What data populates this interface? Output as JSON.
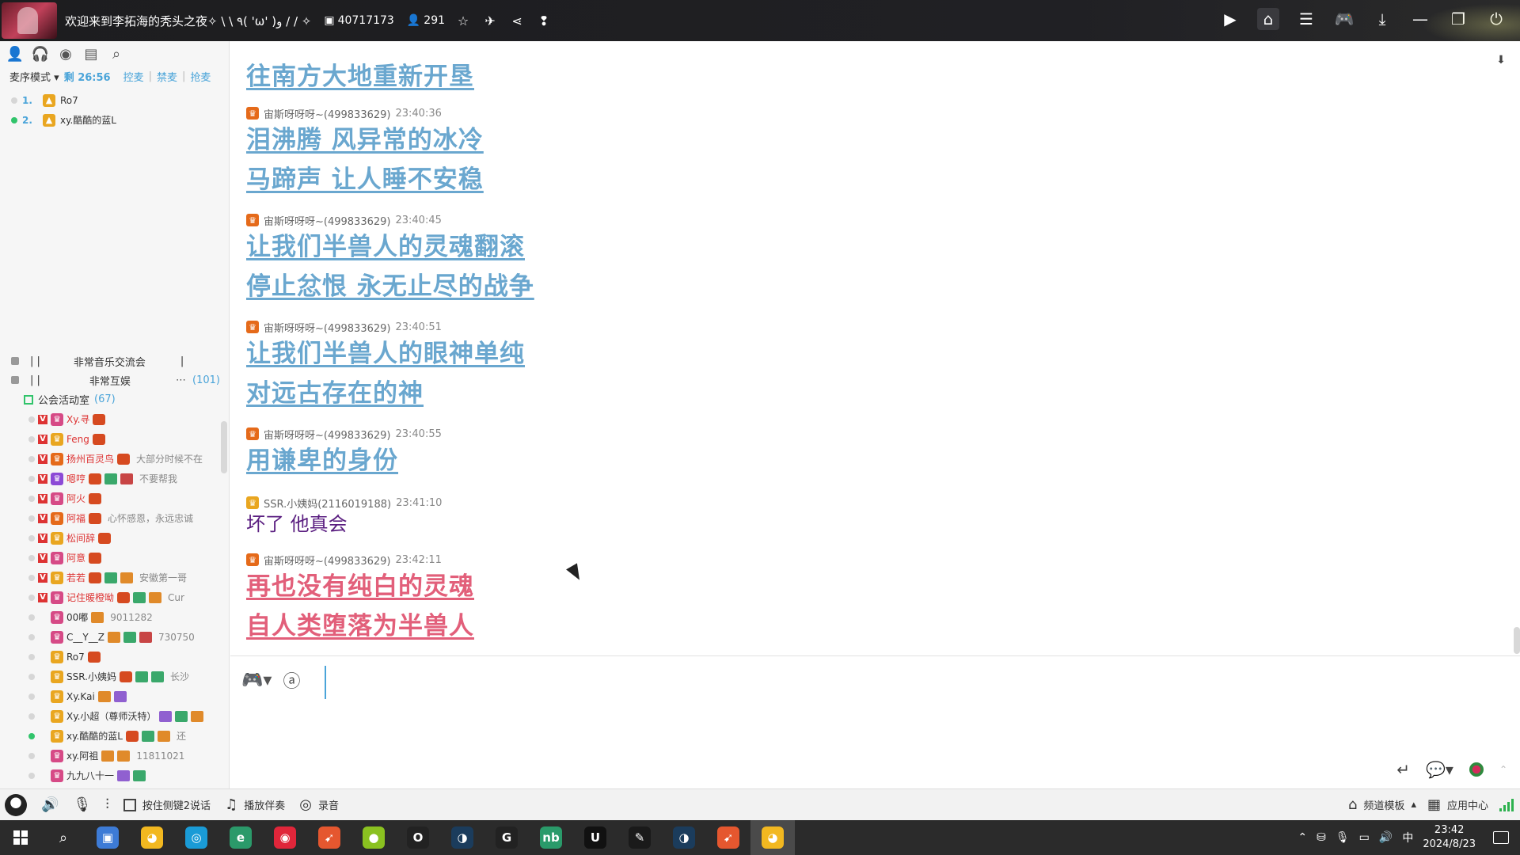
{
  "titlebar": {
    "room_title": "欢迎来到李拓海的秃头之夜✧ \\ \\ ٩( 'ω' )و / / ✧",
    "room_id": "40717173",
    "online_count": "291",
    "icons": [
      "room-id-icon",
      "user-icon",
      "star-icon",
      "plane-icon",
      "share-icon",
      "info-icon"
    ],
    "right_icons": [
      "video-icon",
      "home-icon",
      "list-icon",
      "gamepad-icon",
      "download-icon",
      "minimize-icon",
      "restore-icon",
      "power-icon"
    ]
  },
  "left": {
    "tool_icons": [
      "user-icon",
      "headset-icon",
      "location-icon",
      "notes-icon",
      "search-icon"
    ],
    "mic_mode": "麦序模式",
    "remaining": "剩 26:56",
    "actions": [
      "控麦",
      "禁麦",
      "抢麦"
    ],
    "queue": [
      {
        "num": "1.",
        "name": "Ro7",
        "online": false
      },
      {
        "num": "2.",
        "name": "xy.酷酷的蓝L",
        "online": true
      }
    ],
    "channels": [
      {
        "name": "非常音乐交流会",
        "count": ""
      },
      {
        "name": "非常互娱",
        "count": "(101)"
      }
    ],
    "sub_channel": {
      "name": "公会活动室",
      "count": "(67)"
    },
    "members": [
      {
        "name": "Xy.寻",
        "v": true,
        "sign": ""
      },
      {
        "name": "Feng",
        "v": true,
        "sign": ""
      },
      {
        "name": "扬州百灵鸟",
        "v": true,
        "sign": "大部分时候不在"
      },
      {
        "name": "嗯哼",
        "v": true,
        "sign": "不要帮我"
      },
      {
        "name": "阿火",
        "v": true,
        "sign": ""
      },
      {
        "name": "阿福",
        "v": true,
        "sign": "心怀感恩，永远忠诚"
      },
      {
        "name": "松间辞",
        "v": true,
        "sign": ""
      },
      {
        "name": "阿意",
        "v": true,
        "sign": ""
      },
      {
        "name": "若若",
        "v": true,
        "sign": "安徽第一哥"
      },
      {
        "name": "记住暖橙呦",
        "v": true,
        "sign": "Cur"
      },
      {
        "name": "00嘟",
        "v": false,
        "sign": "9011282"
      },
      {
        "name": "C__Y__Z",
        "v": false,
        "sign": "730750"
      },
      {
        "name": "Ro7",
        "v": false,
        "sign": ""
      },
      {
        "name": "SSR.小姨妈",
        "v": false,
        "sign": "长沙"
      },
      {
        "name": "Xy.Kai",
        "v": false,
        "sign": ""
      },
      {
        "name": "Xy.小超（尊师沃特）",
        "v": false,
        "sign": ""
      },
      {
        "name": "xy.酷酷的蓝L",
        "v": false,
        "sign": "还"
      },
      {
        "name": "xy.阿祖",
        "v": false,
        "sign": "11811021"
      },
      {
        "name": "九九八十一",
        "v": false,
        "sign": ""
      }
    ]
  },
  "chat": {
    "messages": [
      {
        "who": "",
        "time": "",
        "lines": [
          "往南方大地重新开垦"
        ],
        "style": "blue"
      },
      {
        "who": "宙斯呀呀呀~(499833629)",
        "time": "23:40:36",
        "lines": [
          "泪沸腾 风异常的冰冷",
          "马蹄声 让人睡不安稳"
        ],
        "style": "blue"
      },
      {
        "who": "宙斯呀呀呀~(499833629)",
        "time": "23:40:45",
        "lines": [
          "让我们半兽人的灵魂翻滚",
          "停止忿恨 永无止尽的战争"
        ],
        "style": "blue"
      },
      {
        "who": "宙斯呀呀呀~(499833629)",
        "time": "23:40:51",
        "lines": [
          "让我们半兽人的眼神单纯",
          "对远古存在的神"
        ],
        "style": "blue"
      },
      {
        "who": "宙斯呀呀呀~(499833629)",
        "time": "23:40:55",
        "lines": [
          "用谦卑的身份"
        ],
        "style": "blue"
      },
      {
        "who": "SSR.小姨妈(2116019188)",
        "time": "23:41:10",
        "lines": [
          "坏了 他真会"
        ],
        "style": "plain"
      },
      {
        "who": "宙斯呀呀呀~(499833629)",
        "time": "23:42:11",
        "lines": [
          "再也没有纯白的灵魂",
          "自人类堕落为半兽人"
        ],
        "style": "pink"
      }
    ]
  },
  "bottombar": {
    "push_to_talk": "按住侧键2说话",
    "play_music": "播放伴奏",
    "record": "录音",
    "channel_template": "频道模板",
    "app_center": "应用中心"
  },
  "taskbar": {
    "time": "23:42",
    "date": "2024/8/23",
    "ime": "中",
    "apps": [
      {
        "name": "explorer-app",
        "color": "#3d7bd6",
        "glyph": "▣"
      },
      {
        "name": "yy-app",
        "color": "#f2b820",
        "glyph": "◕"
      },
      {
        "name": "cortana-app",
        "color": "#1a9bd6",
        "glyph": "◎"
      },
      {
        "name": "edge-app",
        "color": "#2b9a6a",
        "glyph": "e"
      },
      {
        "name": "netease-music-app",
        "color": "#e0263a",
        "glyph": "◉"
      },
      {
        "name": "thunder-app",
        "color": "#e5572f",
        "glyph": "➹"
      },
      {
        "name": "yellow-app",
        "color": "#8ac120",
        "glyph": "●"
      },
      {
        "name": "osu-app",
        "color": "#222",
        "glyph": "O"
      },
      {
        "name": "steam-app",
        "color": "#1b3c5c",
        "glyph": "◑"
      },
      {
        "name": "g-app",
        "color": "#222",
        "glyph": "G"
      },
      {
        "name": "nb-app",
        "color": "#2a9a6a",
        "glyph": "nb"
      },
      {
        "name": "unreal-app",
        "color": "#111",
        "glyph": "U"
      },
      {
        "name": "editor-app",
        "color": "#1a1a1a",
        "glyph": "✎"
      },
      {
        "name": "steam2-app",
        "color": "#1b3c5c",
        "glyph": "◑"
      },
      {
        "name": "thunder2-app",
        "color": "#e5572f",
        "glyph": "➹"
      },
      {
        "name": "yy2-app",
        "color": "#f2b820",
        "glyph": "◕"
      }
    ]
  }
}
